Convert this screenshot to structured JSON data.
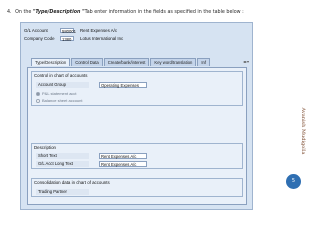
{
  "instruction": {
    "step": "4.",
    "pre": "On the ",
    "emphasis": "\"Type/Description \"",
    "post": "Tab enter information in the fields as specified in the table below :"
  },
  "header": {
    "gl_account_label": "G/L Account",
    "gl_account_value": "580001",
    "gl_account_desc": "Rent Expenses A/c",
    "company_code_label": "Company Code",
    "company_code_value": "1380",
    "company_code_desc": "Lotus International Inc"
  },
  "tabs": [
    {
      "label": "Type/Description",
      "active": true
    },
    {
      "label": "Control Data"
    },
    {
      "label": "Create/bank/interest"
    },
    {
      "label": "Key word/translation"
    },
    {
      "label": "Inf"
    }
  ],
  "control_group": {
    "title": "Control in chart of accounts",
    "account_group_label": "Account Group",
    "account_group_value": "Operating Expenses",
    "radio_pl": "P&L statement acct",
    "radio_bs": "Balance sheet account"
  },
  "description_group": {
    "title": "Description",
    "short_text_label": "Short Text",
    "short_text_value": "Rent Expenses A/c",
    "long_text_label": "G/L Acct Long Text",
    "long_text_value": "Rent Expenses A/c"
  },
  "consolidation_group": {
    "title": "Consolidation data in chart of accounts",
    "trading_partner_label": "Trading Partner"
  },
  "side_name": "Avanish Mudigolla",
  "page_number": "5",
  "colors": {
    "window_bg": "#d6e3f2",
    "panel_bg": "#e9f0f9",
    "badge": "#2f6fb2",
    "name_text": "#7c4a2e"
  }
}
